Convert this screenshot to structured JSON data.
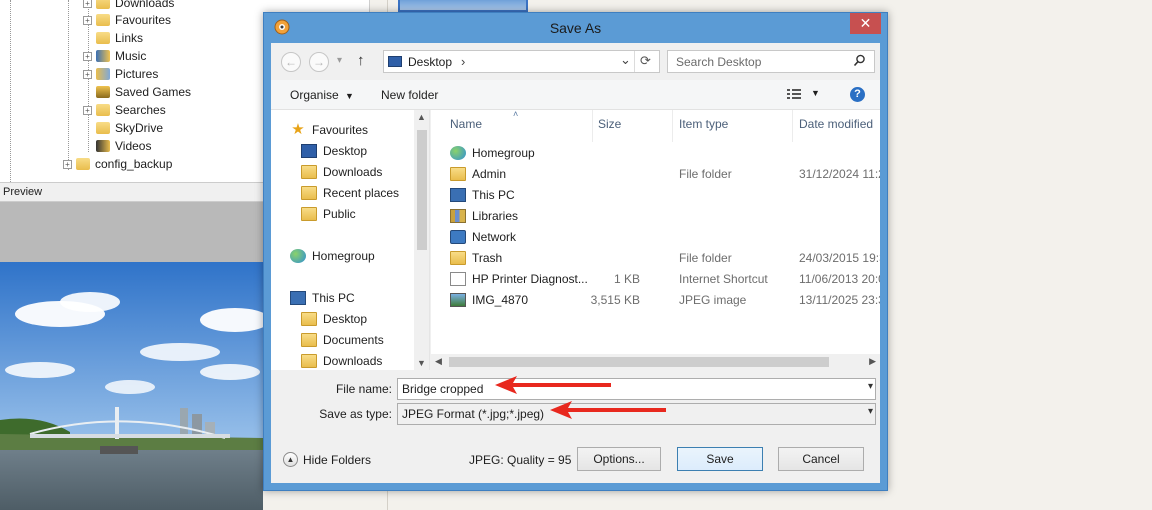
{
  "background": {
    "tree": [
      "Downloads",
      "Favourites",
      "Links",
      "Music",
      "Pictures",
      "Saved Games",
      "Searches",
      "SkyDrive",
      "Videos",
      "config_backup"
    ],
    "preview_label": "Preview"
  },
  "dialog": {
    "title": "Save As",
    "close_glyph": "✕",
    "nav": {
      "back_glyph": "←",
      "forward_glyph": "→",
      "recent_glyph": "▾",
      "up_glyph": "↑"
    },
    "address": {
      "location": "Desktop",
      "chevron": "›",
      "dropdown": "⌄",
      "refresh_glyph": "⟳"
    },
    "search": {
      "placeholder": "Search Desktop",
      "icon": "search-icon"
    },
    "toolbar": {
      "organise_label": "Organise",
      "new_folder_label": "New folder",
      "help_glyph": "?"
    },
    "nav_pane": [
      {
        "label": "Favourites",
        "icon": "star-icon"
      },
      {
        "label": "Desktop",
        "icon": "desktop-icon"
      },
      {
        "label": "Downloads",
        "icon": "downloads-folder-icon"
      },
      {
        "label": "Recent places",
        "icon": "recent-places-icon"
      },
      {
        "label": "Public",
        "icon": "folder-icon"
      },
      {
        "label": "Homegroup",
        "icon": "homegroup-icon"
      },
      {
        "label": "This PC",
        "icon": "pc-icon"
      },
      {
        "label": "Desktop",
        "icon": "folder-icon"
      },
      {
        "label": "Documents",
        "icon": "folder-icon"
      },
      {
        "label": "Downloads",
        "icon": "downloads-folder-icon"
      }
    ],
    "columns": {
      "name": "Name",
      "size": "Size",
      "type": "Item type",
      "date": "Date modified"
    },
    "files": [
      {
        "name": "Homegroup",
        "size": "",
        "type": "",
        "date": "",
        "icon": "homegroup-icon"
      },
      {
        "name": "Admin",
        "size": "",
        "type": "File folder",
        "date": "31/12/2024 11:2",
        "icon": "user-folder-icon"
      },
      {
        "name": "This PC",
        "size": "",
        "type": "",
        "date": "",
        "icon": "pc-icon"
      },
      {
        "name": "Libraries",
        "size": "",
        "type": "",
        "date": "",
        "icon": "libraries-icon"
      },
      {
        "name": "Network",
        "size": "",
        "type": "",
        "date": "",
        "icon": "network-icon"
      },
      {
        "name": "Trash",
        "size": "",
        "type": "File folder",
        "date": "24/03/2015 19:3",
        "icon": "folder-icon"
      },
      {
        "name": "HP Printer Diagnost...",
        "size": "1 KB",
        "type": "Internet Shortcut",
        "date": "11/06/2013 20:0",
        "icon": "shortcut-icon"
      },
      {
        "name": "IMG_4870",
        "size": "3,515 KB",
        "type": "JPEG image",
        "date": "13/11/2025 23:3",
        "icon": "image-icon"
      }
    ],
    "form": {
      "file_name_label": "File name:",
      "file_name_value": "Bridge cropped",
      "type_label": "Save as type:",
      "type_value": "JPEG Format (*.jpg;*.jpeg)"
    },
    "footer": {
      "hide_folders_label": "Hide Folders",
      "quality_text": "JPEG: Quality = 95",
      "options_label": "Options...",
      "save_label": "Save",
      "cancel_label": "Cancel"
    }
  },
  "colors": {
    "dialog_frame": "#5b9bd5",
    "close_button": "#c75050",
    "annotation_arrow": "#e8281e",
    "primary_button_border": "#3c7fb1"
  }
}
